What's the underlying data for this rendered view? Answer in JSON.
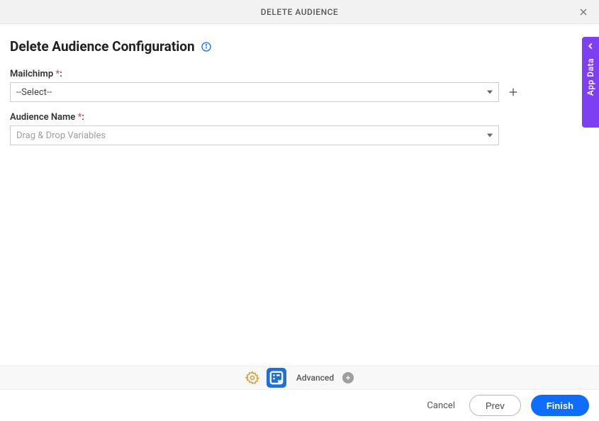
{
  "header": {
    "title": "DELETE AUDIENCE"
  },
  "page": {
    "title": "Delete Audience Configuration"
  },
  "form": {
    "mailchimp_label": "Mailchimp ",
    "mailchimp_required": "*",
    "mailchimp_value": "--Select--",
    "audience_label": "Audience Name ",
    "audience_required": "*",
    "audience_placeholder": "Drag & Drop Variables"
  },
  "toolbar": {
    "advanced_label": "Advanced"
  },
  "footer": {
    "cancel_label": "Cancel",
    "prev_label": "Prev",
    "finish_label": "Finish"
  },
  "side": {
    "label": "App Data"
  }
}
